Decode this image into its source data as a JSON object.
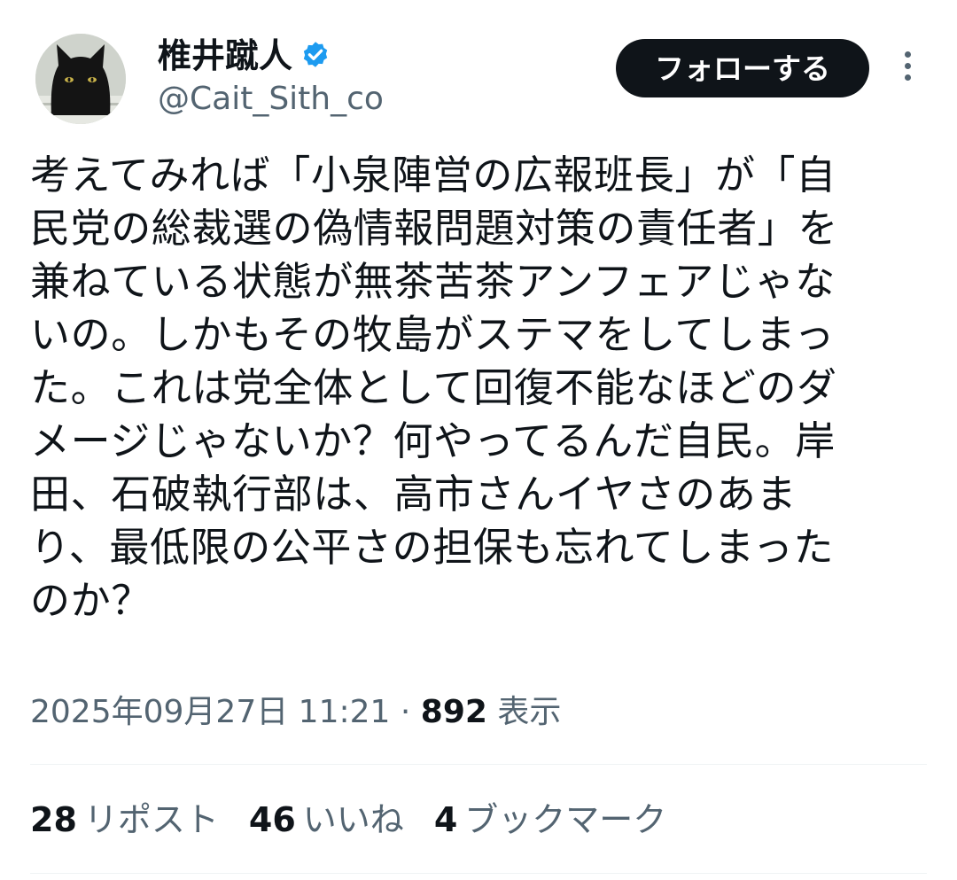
{
  "author": {
    "display_name": "椎井蹴人",
    "handle": "@Cait_Sith_co",
    "verified": true,
    "avatar_icon": "black-cat-avatar"
  },
  "follow_button": {
    "label": "フォローする"
  },
  "more_icon": "more-vertical-icon",
  "tweet": {
    "lines": [
      "考えてみれば「小泉陣営の広報班長」が「自",
      "民党の総裁選の偽情報問題対策の責任者」を",
      "兼ねている状態が無茶苦茶アンフェアじゃな",
      "いの。しかもその牧島がステマをしてしまっ",
      "た。これは党全体として回復不能なほどのダ",
      "メージじゃないか？何やってるんだ自民。岸",
      "田、石破執行部は、高市さんイヤさのあま",
      "り、最低限の公平さの担保も忘れてしまった",
      "のか？"
    ]
  },
  "meta": {
    "timestamp": "2025年09月27日 11:21",
    "separator": "·",
    "views_count": "892",
    "views_label": "表示"
  },
  "stats": {
    "reposts": {
      "count": "28",
      "label": "リポスト"
    },
    "likes": {
      "count": "46",
      "label": "いいね"
    },
    "bookmarks": {
      "count": "4",
      "label": "ブックマーク"
    }
  },
  "colors": {
    "text_primary": "#0f1419",
    "text_secondary": "#536471",
    "verified_blue": "#1d9bf0",
    "follow_bg": "#0f1419",
    "divider": "#eff3f4"
  }
}
